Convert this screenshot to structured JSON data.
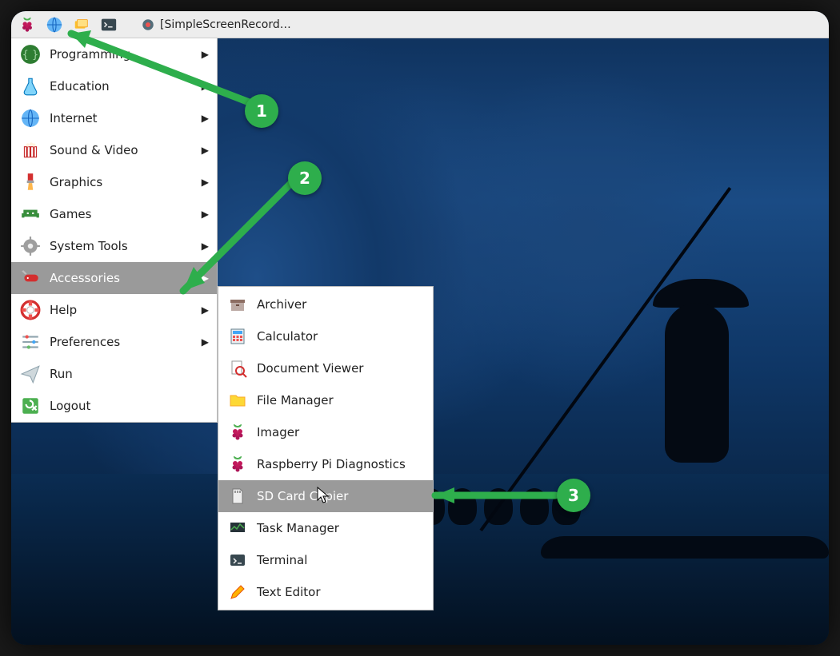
{
  "taskbar": {
    "app_label": "[SimpleScreenRecord…"
  },
  "menu": {
    "items": [
      {
        "label": "Programming",
        "icon": "code-braces-icon",
        "has_submenu": true
      },
      {
        "label": "Education",
        "icon": "flask-icon",
        "has_submenu": true
      },
      {
        "label": "Internet",
        "icon": "globe-icon",
        "has_submenu": true
      },
      {
        "label": "Sound & Video",
        "icon": "popcorn-icon",
        "has_submenu": true
      },
      {
        "label": "Graphics",
        "icon": "paintbrush-icon",
        "has_submenu": true
      },
      {
        "label": "Games",
        "icon": "invader-icon",
        "has_submenu": true
      },
      {
        "label": "System Tools",
        "icon": "gear-icon",
        "has_submenu": true
      },
      {
        "label": "Accessories",
        "icon": "swiss-knife-icon",
        "has_submenu": true,
        "highlighted": true
      },
      {
        "label": "Help",
        "icon": "lifebuoy-icon",
        "has_submenu": true
      },
      {
        "label": "Preferences",
        "icon": "sliders-icon",
        "has_submenu": true
      },
      {
        "label": "Run",
        "icon": "paperplane-icon",
        "has_submenu": false
      },
      {
        "label": "Logout",
        "icon": "exit-icon",
        "has_submenu": false
      }
    ]
  },
  "submenu": {
    "parent": "Accessories",
    "items": [
      {
        "label": "Archiver",
        "icon": "archive-icon"
      },
      {
        "label": "Calculator",
        "icon": "calculator-icon"
      },
      {
        "label": "Document Viewer",
        "icon": "magnifier-doc-icon"
      },
      {
        "label": "File Manager",
        "icon": "folder-icon"
      },
      {
        "label": "Imager",
        "icon": "raspberry-icon"
      },
      {
        "label": "Raspberry Pi Diagnostics",
        "icon": "raspberry-icon"
      },
      {
        "label": "SD Card Copier",
        "icon": "sdcard-icon",
        "highlighted": true
      },
      {
        "label": "Task Manager",
        "icon": "monitor-graph-icon"
      },
      {
        "label": "Terminal",
        "icon": "terminal-icon"
      },
      {
        "label": "Text Editor",
        "icon": "pencil-icon"
      }
    ]
  },
  "annotations": {
    "badges": {
      "1": "1",
      "2": "2",
      "3": "3"
    },
    "accent_color": "#2eae4c"
  }
}
